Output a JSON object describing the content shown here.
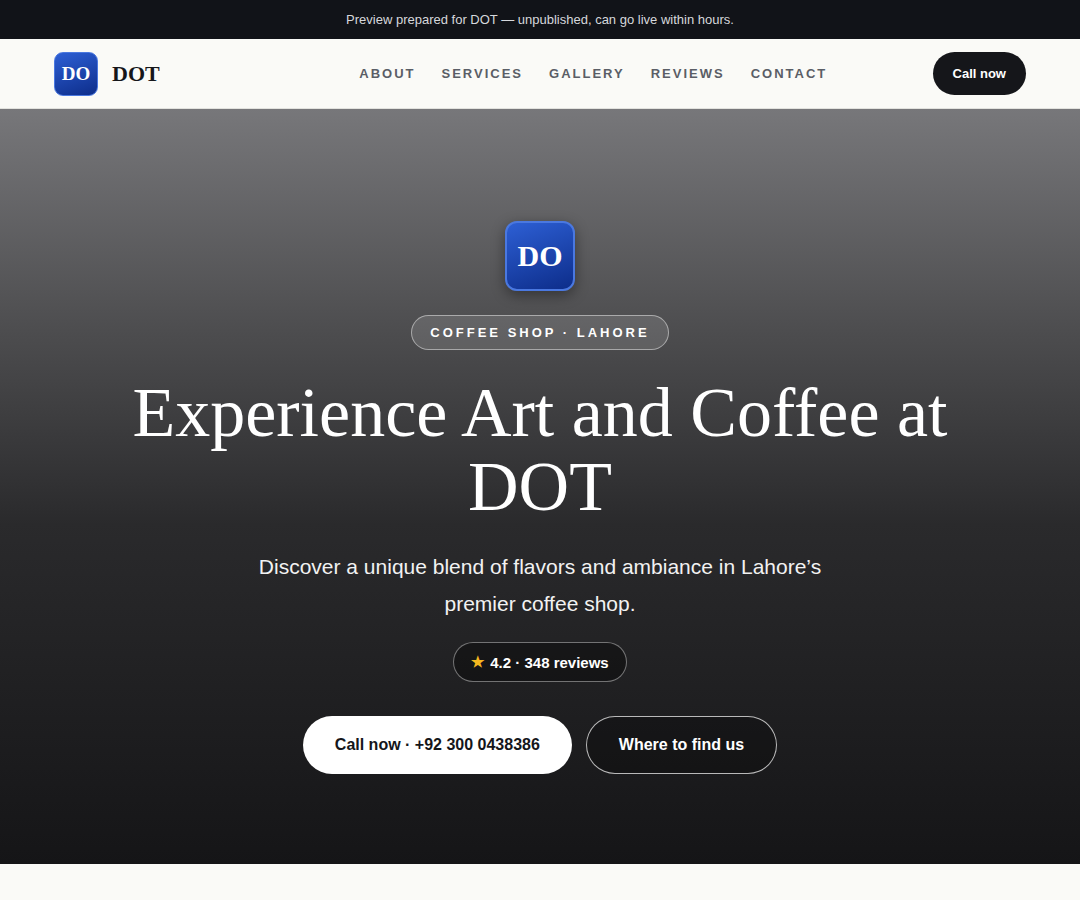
{
  "banner": {
    "text": "Preview prepared for DOT — unpublished, can go live within hours."
  },
  "header": {
    "logo": "DO",
    "brand": "DOT",
    "nav": [
      {
        "label": "ABOUT"
      },
      {
        "label": "SERVICES"
      },
      {
        "label": "GALLERY"
      },
      {
        "label": "REVIEWS"
      },
      {
        "label": "CONTACT"
      }
    ],
    "cta": "Call now"
  },
  "hero": {
    "logo": "DO",
    "badge": "COFFEE SHOP · LAHORE",
    "title": "Experience Art and Coffee at DOT",
    "subtitle": "Discover a unique blend of flavors and ambiance in Lahore’s premier coffee shop.",
    "rating": {
      "icon": "★",
      "text": "4.2 · 348 reviews"
    },
    "buttons": [
      {
        "label": "Call now · +92 300 0438386",
        "kind": "primary"
      },
      {
        "label": "Where to find us",
        "kind": "secondary"
      }
    ]
  }
}
